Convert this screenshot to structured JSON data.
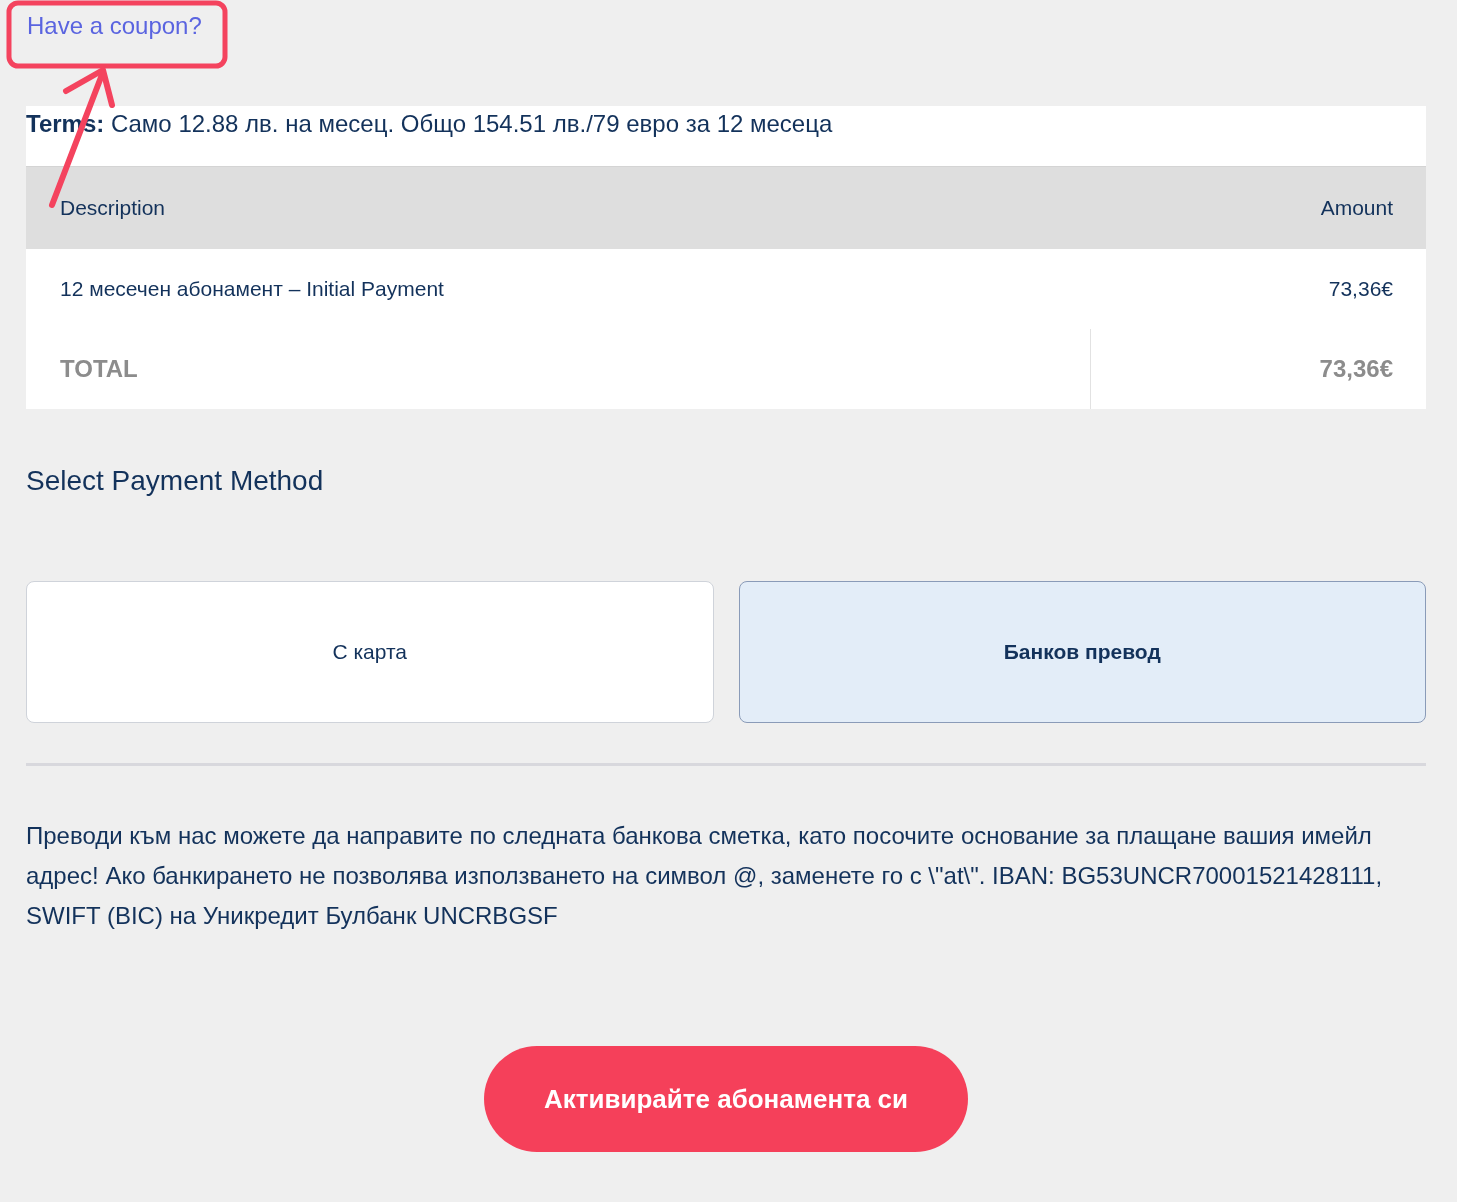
{
  "coupon_link": "Have a coupon?",
  "annotation": {
    "kind": "highlight-arrow"
  },
  "terms": "**Terms:** Само 12.88 лв. на месец. Общо 154.51 лв./79 евро за 12 месеца",
  "table": {
    "columns": [
      "Description",
      "Amount"
    ],
    "rows": [
      {
        "description": "12 месечен абонамент – Initial Payment",
        "amount": "73,36€"
      }
    ],
    "total": {
      "label": "TOTAL",
      "amount": "73,36€"
    }
  },
  "payment_heading": "Select Payment Method",
  "payment_methods": [
    {
      "label": "С карта",
      "selected": false
    },
    {
      "label": "Банков превод",
      "selected": true
    }
  ],
  "instructions": "Преводи към нас можете да направите по следната банкова сметка, като посочите основание за плащане вашия имейл адрес! Ако банкирането не позволява използването на символ @, заменете го с \\\"at\\\". IBAN: BG53UNCR70001521428111, SWIFT (BIC) на Уникредит Булбанк UNCRBGSF",
  "submit_button": "Активирайте абонамента си"
}
